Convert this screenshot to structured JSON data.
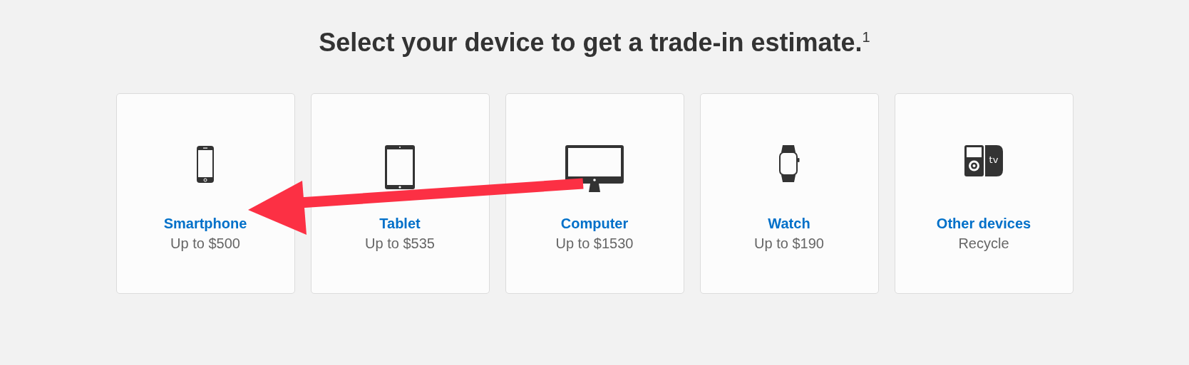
{
  "heading": "Select your device to get a trade-in estimate.$^{1}$",
  "devices": [
    {
      "kind": "phone",
      "name": "Smartphone",
      "value": "Up to $500"
    },
    {
      "kind": "tablet",
      "name": "Tablet",
      "value": "Up to $535"
    },
    {
      "kind": "computer",
      "name": "Computer",
      "value": "Up to $1530"
    },
    {
      "kind": "watch",
      "name": "Watch",
      "value": "Up to $190"
    },
    {
      "kind": "other",
      "name": "Other devices",
      "value": "Recycle",
      "icon_text": "tv"
    }
  ]
}
